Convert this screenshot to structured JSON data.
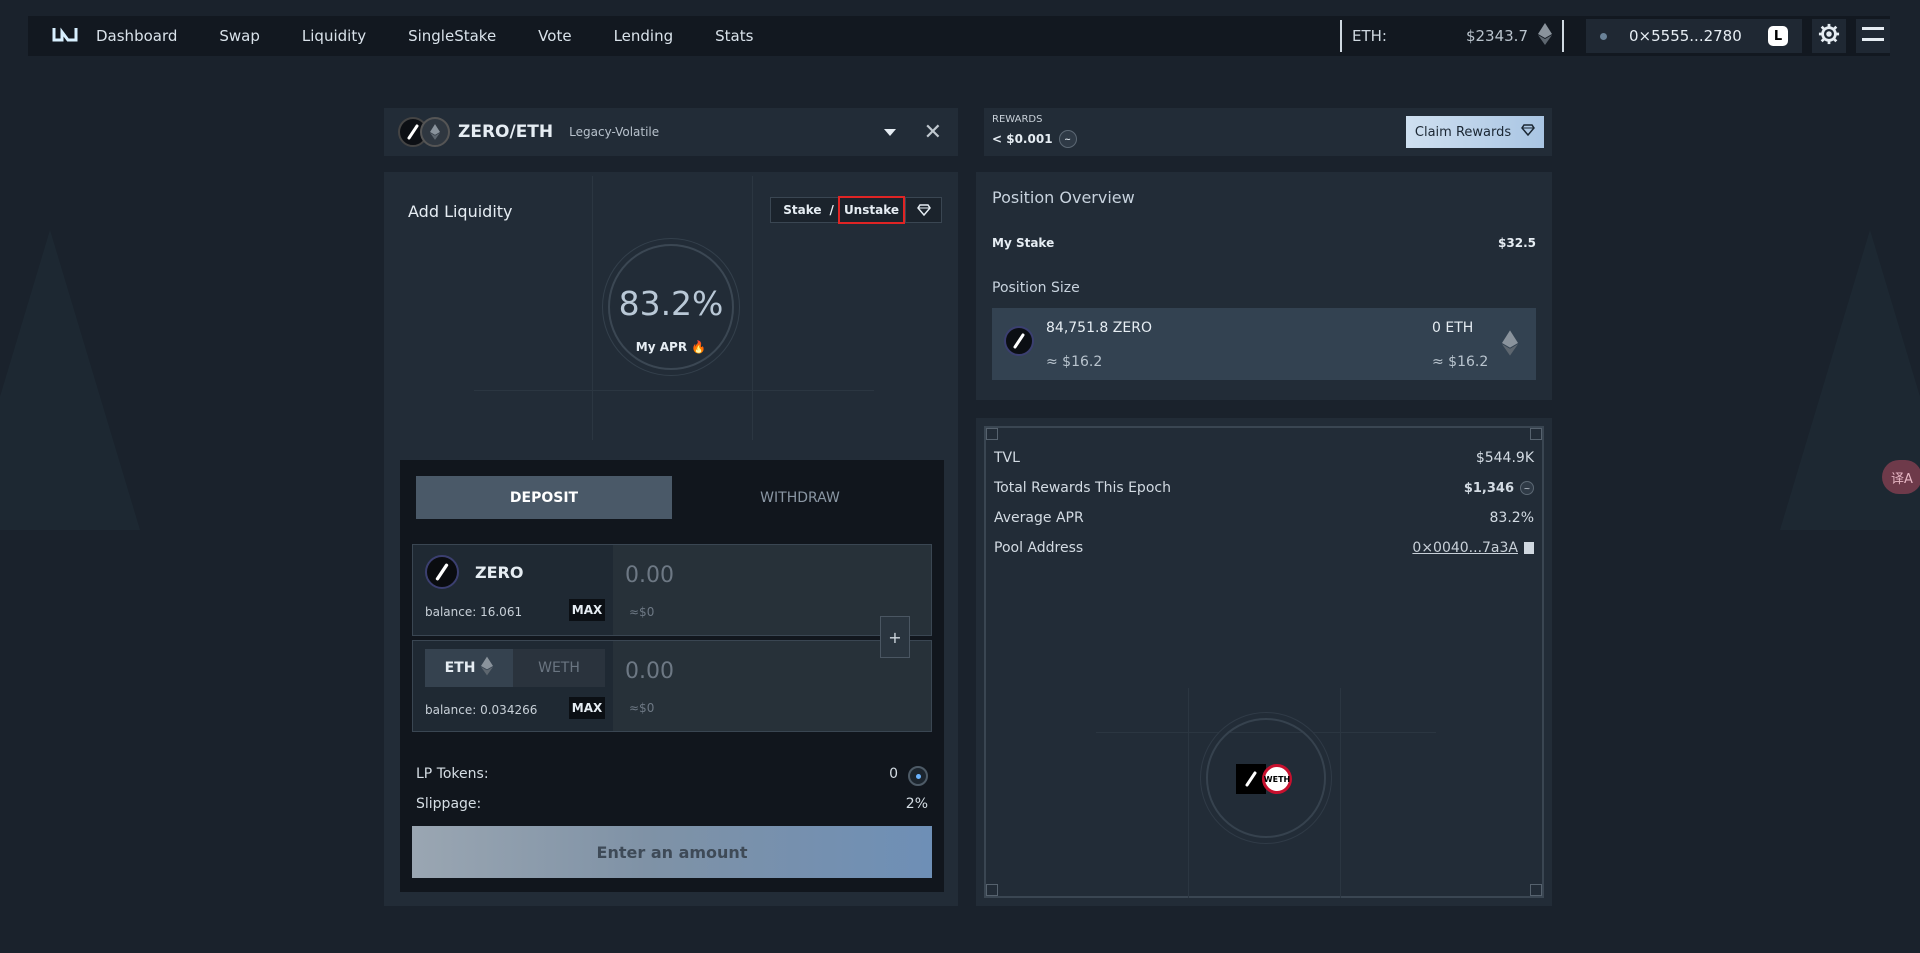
{
  "nav": {
    "links": [
      "Dashboard",
      "Swap",
      "Liquidity",
      "SingleStake",
      "Vote",
      "Lending",
      "Stats"
    ],
    "eth_label": "ETH:",
    "eth_price": "$2343.7",
    "wallet_address": "0×5555...2780"
  },
  "pair": {
    "name": "ZERO/ETH",
    "type": "Legacy-Volatile"
  },
  "add_liquidity": {
    "title": "Add Liquidity",
    "stake_label": "Stake",
    "separator": "/",
    "unstake_label": "Unstake",
    "apr_value": "83.2%",
    "apr_label": "My APR"
  },
  "deposit": {
    "tab_deposit": "DEPOSIT",
    "tab_withdraw": "WITHDRAW",
    "token1": {
      "name": "ZERO",
      "balance": "balance: 16.061",
      "max": "MAX",
      "amount": "0.00",
      "usd": "≈$0"
    },
    "token2": {
      "name": "ETH",
      "alt_name": "WETH",
      "balance": "balance: 0.034266",
      "max": "MAX",
      "amount": "0.00",
      "usd": "≈$0"
    },
    "plus": "+",
    "lp_tokens_label": "LP Tokens:",
    "lp_tokens_value": "0",
    "slippage_label": "Slippage:",
    "slippage_value": "2%",
    "submit_label": "Enter an amount"
  },
  "rewards": {
    "label": "REWARDS",
    "value": "< $0.001",
    "claim_label": "Claim Rewards"
  },
  "position": {
    "title": "Position Overview",
    "my_stake_label": "My Stake",
    "my_stake_value": "$32.5",
    "size_label": "Position Size",
    "zero_amount": "84,751.8 ZERO",
    "zero_usd": "≈ $16.2",
    "eth_amount": "0 ETH",
    "eth_usd": "≈ $16.2"
  },
  "pool": {
    "tvl_label": "TVL",
    "tvl_value": "$544.9K",
    "rewards_label": "Total Rewards This Epoch",
    "rewards_value": "$1,346",
    "apr_label": "Average APR",
    "apr_value": "83.2%",
    "address_label": "Pool Address",
    "address_value": "0×0040...7a3A",
    "weth_logo_text": "WETH"
  },
  "translate_icon_text": "译A",
  "colors": {
    "background": "#1a222c",
    "panel": "#222c37",
    "accent_red": "#e02424",
    "claim_gradient_start": "#cfe0f0",
    "claim_gradient_end": "#a9c5e3"
  }
}
